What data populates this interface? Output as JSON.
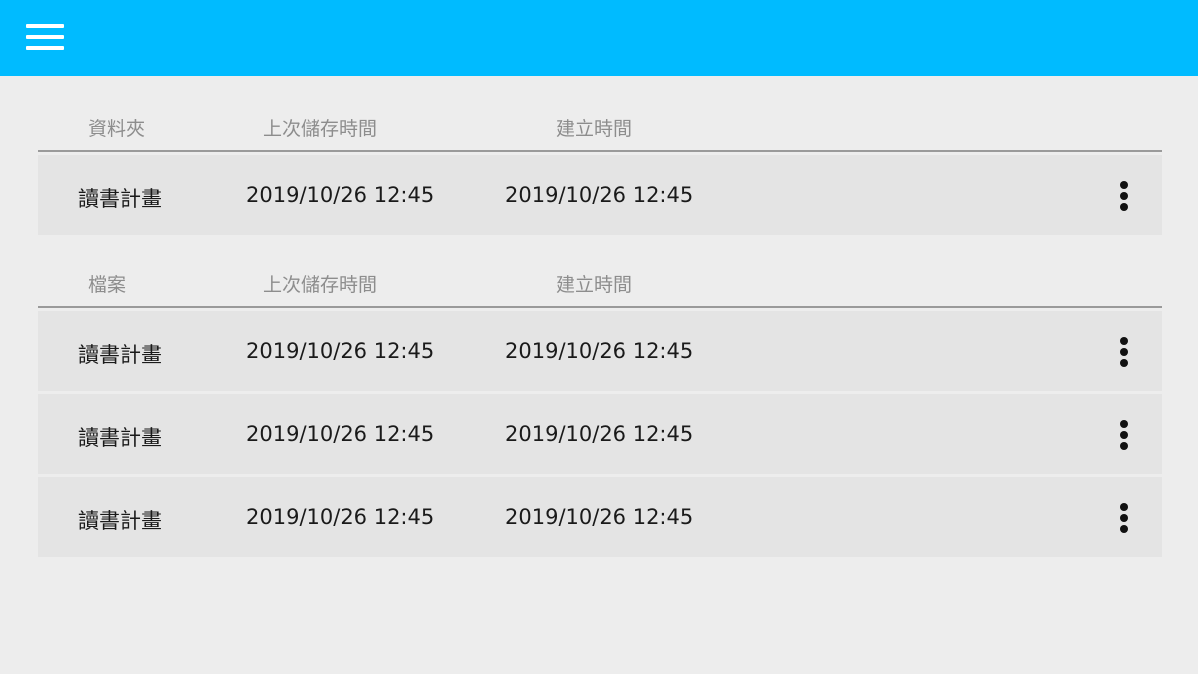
{
  "colors": {
    "topbar": "#00bbff",
    "background": "#ededed",
    "row_background": "#e4e4e4",
    "header_text": "#8d8d8d",
    "row_text": "#1a1a1a"
  },
  "topbar": {
    "menu_icon": "hamburger-menu-icon"
  },
  "folders": {
    "headers": {
      "name": "資料夾",
      "saved": "上次儲存時間",
      "created": "建立時間"
    },
    "rows": [
      {
        "name": "讀書計畫",
        "saved": "2019/10/26 12:45",
        "created": "2019/10/26 12:45",
        "menu_icon": "more-vertical-icon"
      }
    ]
  },
  "files": {
    "headers": {
      "name": "檔案",
      "saved": "上次儲存時間",
      "created": "建立時間"
    },
    "rows": [
      {
        "name": "讀書計畫",
        "saved": "2019/10/26 12:45",
        "created": "2019/10/26 12:45",
        "menu_icon": "more-vertical-icon"
      },
      {
        "name": "讀書計畫",
        "saved": "2019/10/26 12:45",
        "created": "2019/10/26 12:45",
        "menu_icon": "more-vertical-icon"
      },
      {
        "name": "讀書計畫",
        "saved": "2019/10/26 12:45",
        "created": "2019/10/26 12:45",
        "menu_icon": "more-vertical-icon"
      }
    ]
  }
}
